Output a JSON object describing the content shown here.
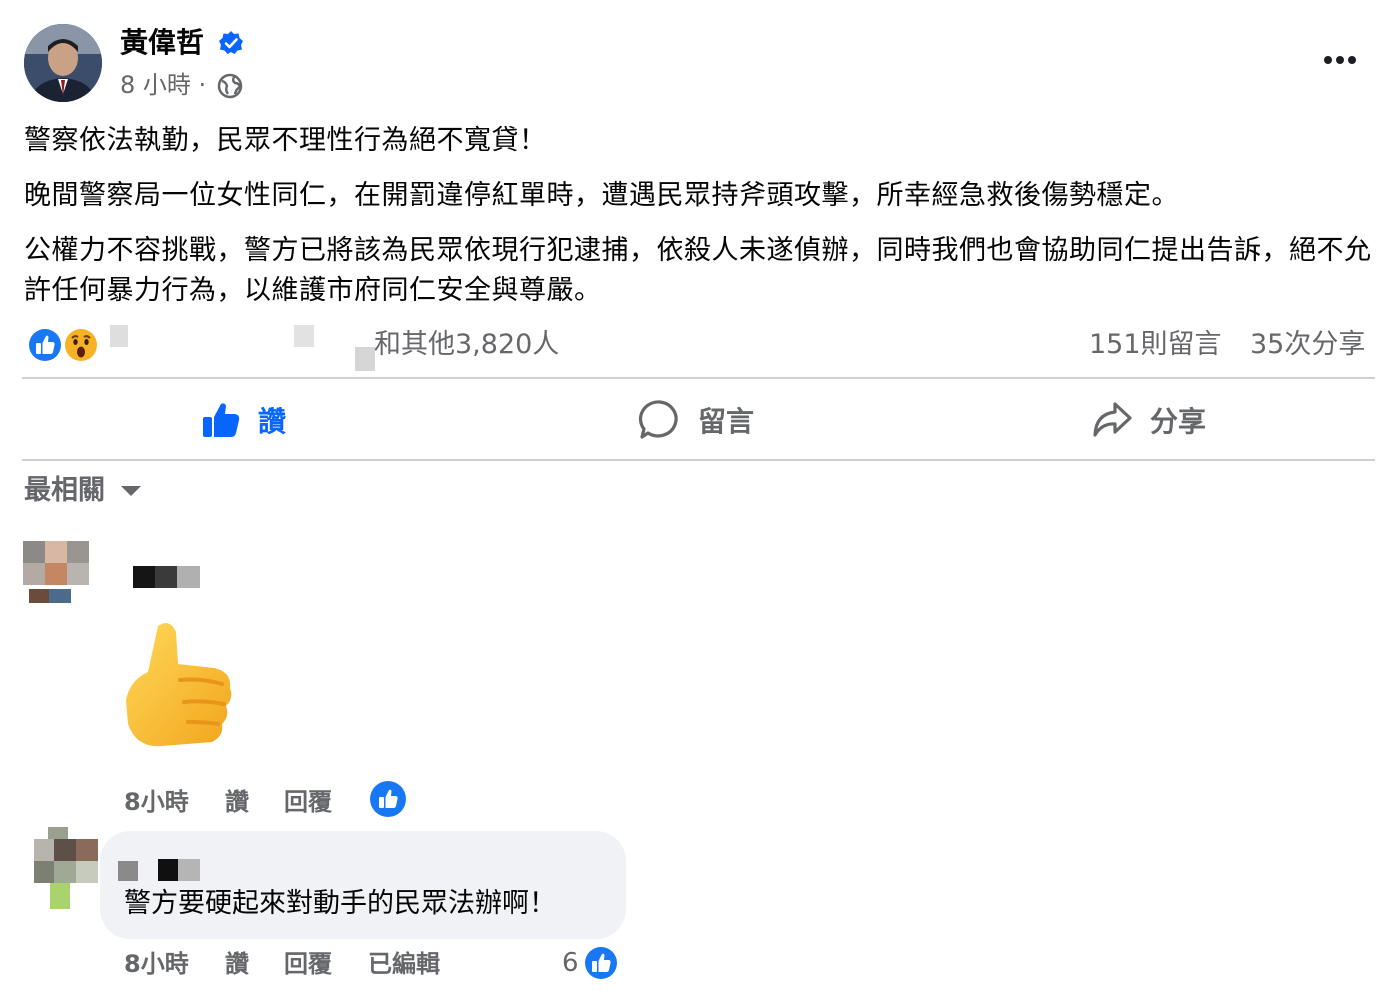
{
  "post": {
    "author": "黃偉哲",
    "time": "8 小時 ·",
    "paragraphs": [
      "警察依法執勤，民眾不理性行為絕不寬貸！",
      "晚間警察局一位女性同仁，在開罰違停紅單時，遭遇民眾持斧頭攻擊，所幸經急救後傷勢穩定。",
      "公權力不容挑戰，警方已將該為民眾依現行犯逮捕，依殺人未遂偵辦，同時我們也會協助同仁提出告訴，絕不允許任何暴力行為，以維護市府同仁安全與尊嚴。"
    ],
    "reactions_text": "和其他3,820人",
    "comments_count": "151則留言",
    "shares_count": "35次分享"
  },
  "actions": {
    "like": "讚",
    "comment": "留言",
    "share": "分享"
  },
  "sort_label": "最相關",
  "comments": [
    {
      "time": "8小時",
      "like_label": "讚",
      "reply_label": "回覆"
    },
    {
      "text": "警方要硬起來對動手的民眾法辦啊！",
      "time": "8小時",
      "like_label": "讚",
      "reply_label": "回覆",
      "edited_label": "已編輯",
      "likes": "6"
    }
  ],
  "colors": {
    "accent": "#0866ff",
    "secondary_text": "#65676b",
    "bubble": "#f0f2f5"
  }
}
